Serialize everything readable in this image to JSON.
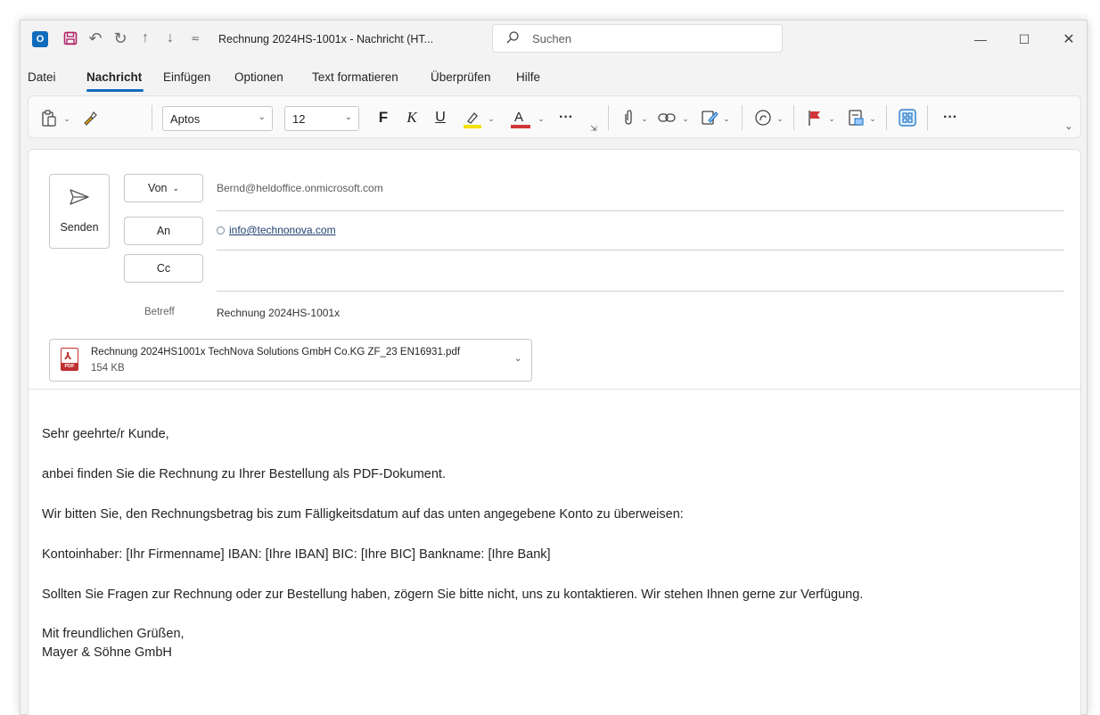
{
  "window": {
    "title": "Rechnung 2024HS-1001x  -  Nachricht (HT..."
  },
  "search": {
    "placeholder": "Suchen"
  },
  "menu": {
    "items": [
      "Datei",
      "Nachricht",
      "Einfügen",
      "Optionen",
      "Text formatieren",
      "Überprüfen",
      "Hilfe"
    ],
    "active": "Nachricht"
  },
  "ribbon": {
    "font": "Aptos",
    "size": "12",
    "bold": "F",
    "italic": "K",
    "underline": "U",
    "more": "···"
  },
  "compose": {
    "send_label": "Senden",
    "from_label": "Von",
    "to_label": "An",
    "cc_label": "Cc",
    "from_value": "Bernd@heldoffice.onmicrosoft.com",
    "to_value": "info@technonova.com",
    "subject_label": "Betreff",
    "subject_value": "Rechnung 2024HS-1001x"
  },
  "attachment": {
    "name": "Rechnung 2024HS1001x TechNova Solutions GmbH  Co.KG ZF_23 EN16931.pdf",
    "size": "154 KB"
  },
  "body": {
    "greeting": "Sehr geehrte/r Kunde,",
    "p1": "anbei finden Sie die Rechnung zu Ihrer Bestellung als PDF-Dokument.",
    "p2": "Wir bitten Sie, den Rechnungsbetrag bis zum Fälligkeitsdatum auf das unten angegebene Konto zu überweisen:",
    "p3": "Kontoinhaber: [Ihr Firmenname] IBAN: [Ihre IBAN] BIC: [Ihre BIC] Bankname: [Ihre Bank]",
    "p4": "Sollten Sie Fragen zur Rechnung oder zur Bestellung haben, zögern Sie bitte nicht, uns zu kontaktieren. Wir stehen Ihnen gerne zur Verfügung.",
    "closing": "Mit freundlichen Grüßen,",
    "signature": "Mayer & Söhne GmbH"
  },
  "colors": {
    "accent": "#0f6cbd",
    "highlight": "#f5e100",
    "font_color": "#d13438",
    "flag": "#d13438"
  }
}
